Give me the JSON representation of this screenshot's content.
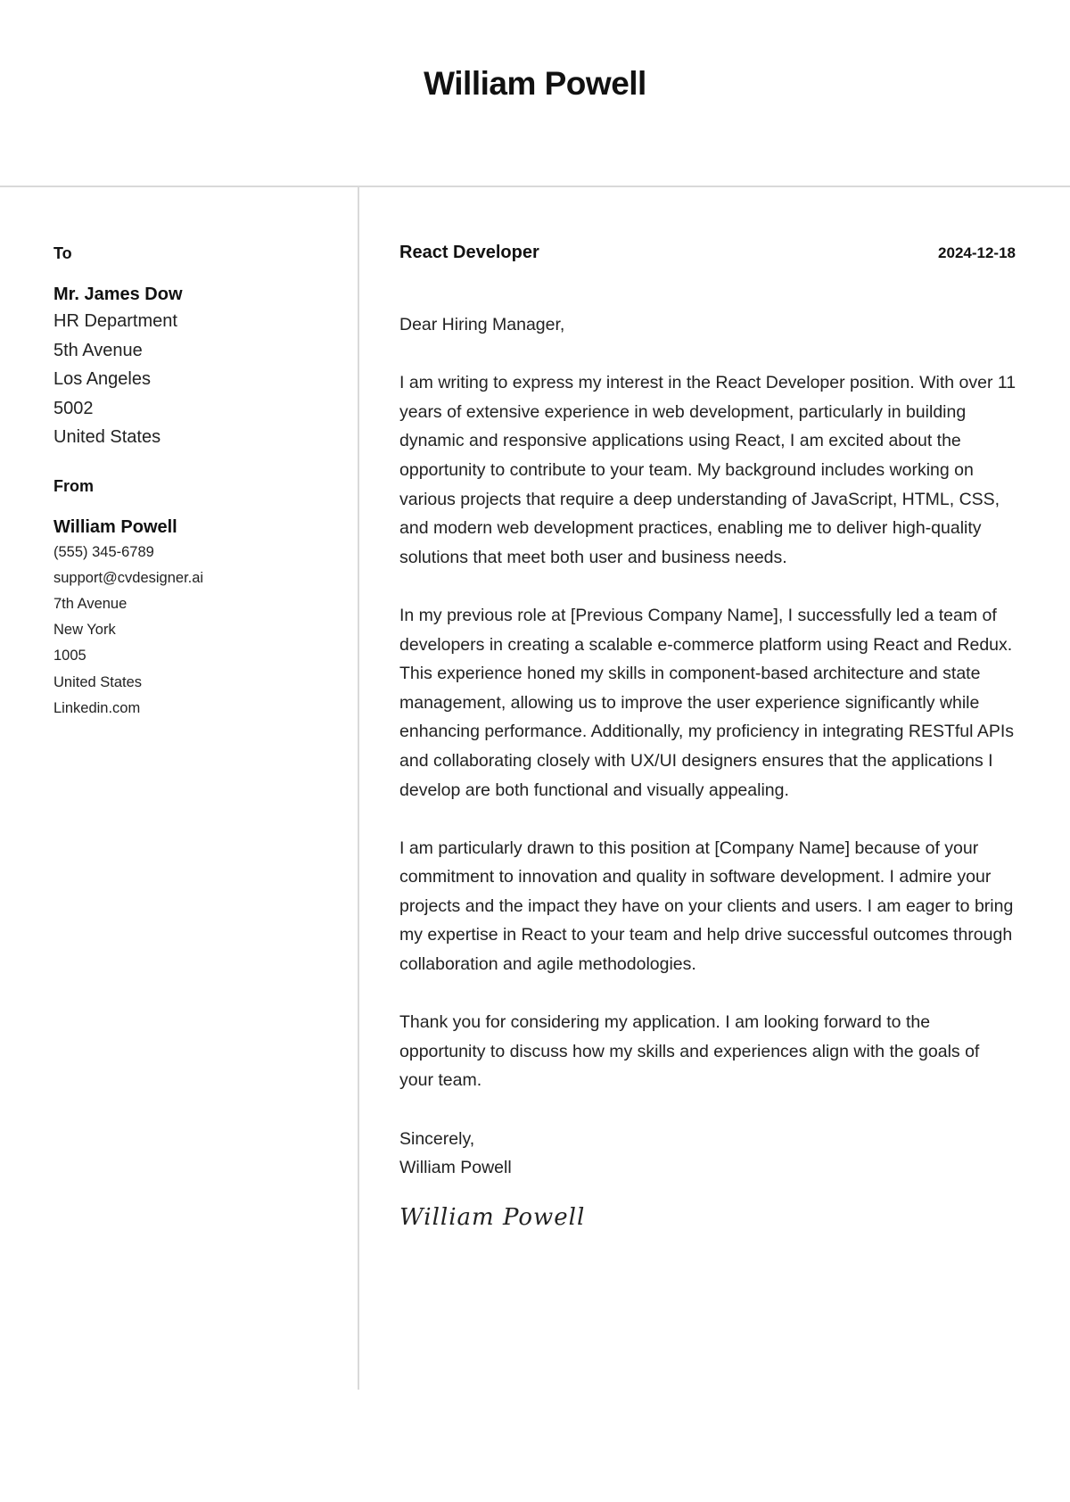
{
  "header": {
    "name": "William Powell"
  },
  "recipient": {
    "label": "To",
    "name": "Mr. James Dow",
    "lines": [
      "HR Department",
      "5th Avenue",
      "Los Angeles",
      "5002",
      "United States"
    ]
  },
  "sender": {
    "label": "From",
    "name": "William Powell",
    "phone": "(555) 345-6789",
    "email": "support@cvdesigner.ai",
    "street": "7th Avenue",
    "city": "New York",
    "zip": "1005",
    "country": "United States",
    "website": "Linkedin.com"
  },
  "letter": {
    "job_title": "React Developer",
    "date": "2024-12-18",
    "salutation": "Dear Hiring Manager,",
    "paragraphs": [
      "I am writing to express my interest in the React Developer position. With over 11 years of extensive experience in web development, particularly in building dynamic and responsive applications using React, I am excited about the opportunity to contribute to your team. My background includes working on various projects that require a deep understanding of JavaScript, HTML, CSS, and modern web development practices, enabling me to deliver high-quality solutions that meet both user and business needs.",
      "In my previous role at [Previous Company Name], I successfully led a team of developers in creating a scalable e-commerce platform using React and Redux. This experience honed my skills in component-based architecture and state management, allowing us to improve the user experience significantly while enhancing performance. Additionally, my proficiency in integrating RESTful APIs and collaborating closely with UX/UI designers ensures that the applications I develop are both functional and visually appealing.",
      "I am particularly drawn to this position at [Company Name] because of your commitment to innovation and quality in software development. I admire your projects and the impact they have on your clients and users. I am eager to bring my expertise in React to your team and help drive successful outcomes through collaboration and agile methodologies.",
      "Thank you for considering my application. I am looking forward to the opportunity to discuss how my skills and experiences align with the goals of your team."
    ],
    "closing": "Sincerely,",
    "closing_name": "William Powell",
    "signature": "William Powell"
  }
}
